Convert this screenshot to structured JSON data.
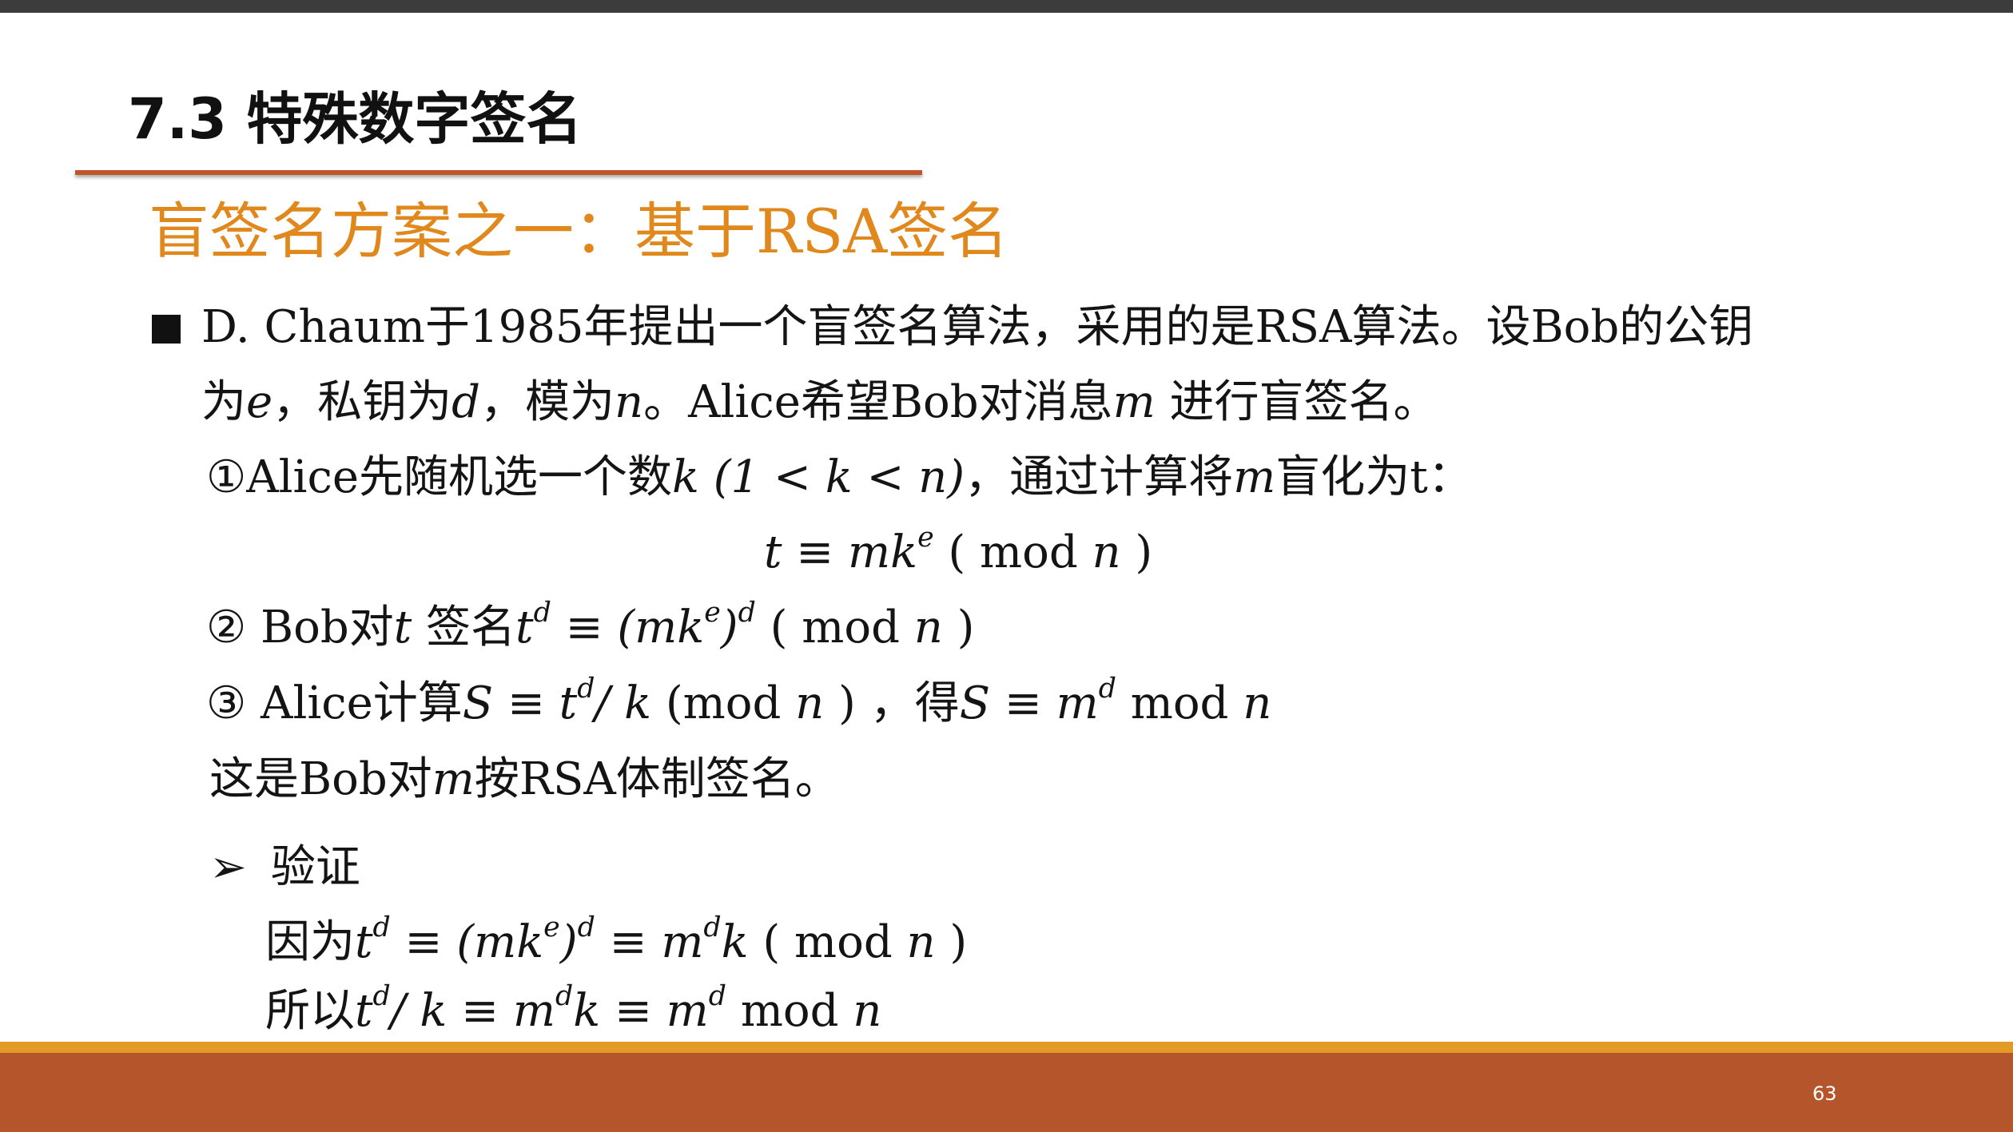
{
  "section_title": "7.3 特殊数字签名",
  "heading": "盲签名方案之一：基于RSA签名",
  "intro": {
    "line1": "D.  Chaum于1985年提出一个盲签名算法，采用的是RSA算法。设Bob的公钥",
    "line2_prefix": "为",
    "line2_e": "e",
    "line2_mid1": "，私钥为",
    "line2_d": "d",
    "line2_mid2": "，模为",
    "line2_n": "n",
    "line2_mid3": "。Alice希望Bob对消息",
    "line2_m": "m",
    "line2_suffix": " 进行盲签名。"
  },
  "step1": {
    "prefix": "①Alice先随机选一个数",
    "k": "k",
    "range": " (1 < k < n)",
    "mid": "，通过计算将",
    "m": "m",
    "suffix": "盲化为t："
  },
  "formula1": {
    "lhs": "t  ≡  mk",
    "exp": "e",
    "rhs_pre": " ( mod ",
    "n": "n",
    "rhs_post": " )"
  },
  "step2": {
    "prefix": "② Bob对",
    "t": "t",
    "mid": " 签名",
    "td": "t",
    "d": "d",
    "eq": "  ≡  (mk",
    "e": "e",
    "close": ")",
    "d2": "d",
    "mod_pre": " ( mod ",
    "n": "n",
    "mod_post": " )"
  },
  "step3": {
    "prefix": "③ Alice计算",
    "s": "S",
    "eq1": "  ≡ t",
    "d": "d",
    "div": "/ k",
    "mod_pre": " (mod ",
    "n": "n",
    "mod_post": " )",
    "mid": " ，得",
    "s2": "S",
    "eq2": "  ≡ m",
    "d2": "d",
    "mod2": " mod ",
    "n2": "n"
  },
  "conclusion": {
    "prefix": "这是Bob对",
    "m": "m",
    "suffix": "按RSA体制签名。"
  },
  "verify": {
    "label": "验证",
    "line1_prefix": "因为",
    "line1_t": "t",
    "line1_d": "d",
    "line1_eq": "  ≡  (mk",
    "line1_e": "e",
    "line1_close": ")",
    "line1_d2": "d",
    "line1_eq2": "  ≡ m",
    "line1_d3": "d",
    "line1_k": "k",
    "line1_mod_pre": " ( mod ",
    "line1_n": "n",
    "line1_mod_post": " )",
    "line2_prefix": "所以",
    "line2_t": "t",
    "line2_d": "d",
    "line2_div": "/ k  ≡ m",
    "line2_d2": "d",
    "line2_k": "k",
    "line2_eq": "  ≡ m",
    "line2_d3": "d",
    "line2_mod": " mod ",
    "line2_n": "n"
  },
  "page_number": "63",
  "colors": {
    "heading": "#e0881c",
    "rule": "#c0552b",
    "footer_band": "#b5552b",
    "footer_gold": "#e39a27",
    "top_bar": "#3c3c3c"
  }
}
